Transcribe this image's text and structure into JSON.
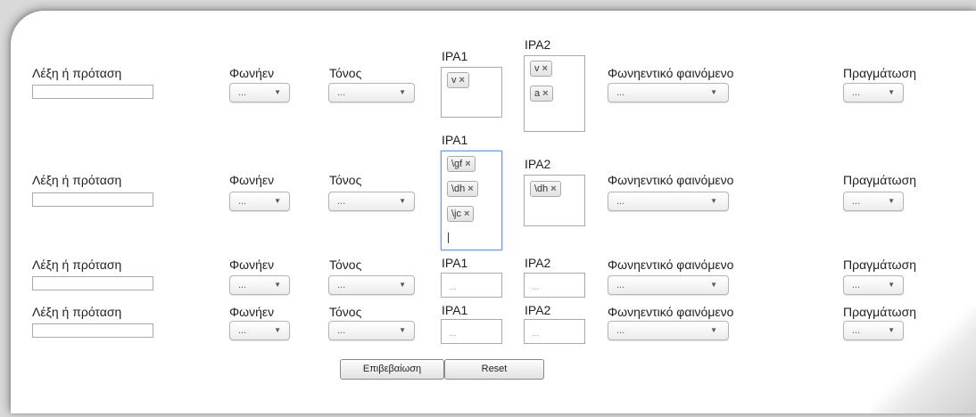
{
  "labels": {
    "word": "Λέξη ή πρόταση",
    "vowel": "Φωνήεν",
    "tone": "Τόνος",
    "ipa1": "IPA1",
    "ipa2": "IPA2",
    "phenomenon": "Φωνηεντικό φαινόμενο",
    "realization": "Πραγμάτωση"
  },
  "select_value": "...",
  "select_arrow": "▼",
  "ipa_placeholder": "...",
  "tag_remove": "×",
  "rows": [
    {
      "ipa1_tags": [
        "v"
      ],
      "ipa2_tags": [
        "v",
        "a"
      ]
    },
    {
      "ipa1_tags": [
        "\\gf",
        "\\dh",
        "\\jc"
      ],
      "ipa2_tags": [
        "\\dh"
      ]
    },
    {
      "ipa1_tags": [],
      "ipa2_tags": []
    },
    {
      "ipa1_tags": [],
      "ipa2_tags": []
    }
  ],
  "buttons": {
    "confirm": "Επιβεβαίωση",
    "reset": "Reset"
  }
}
